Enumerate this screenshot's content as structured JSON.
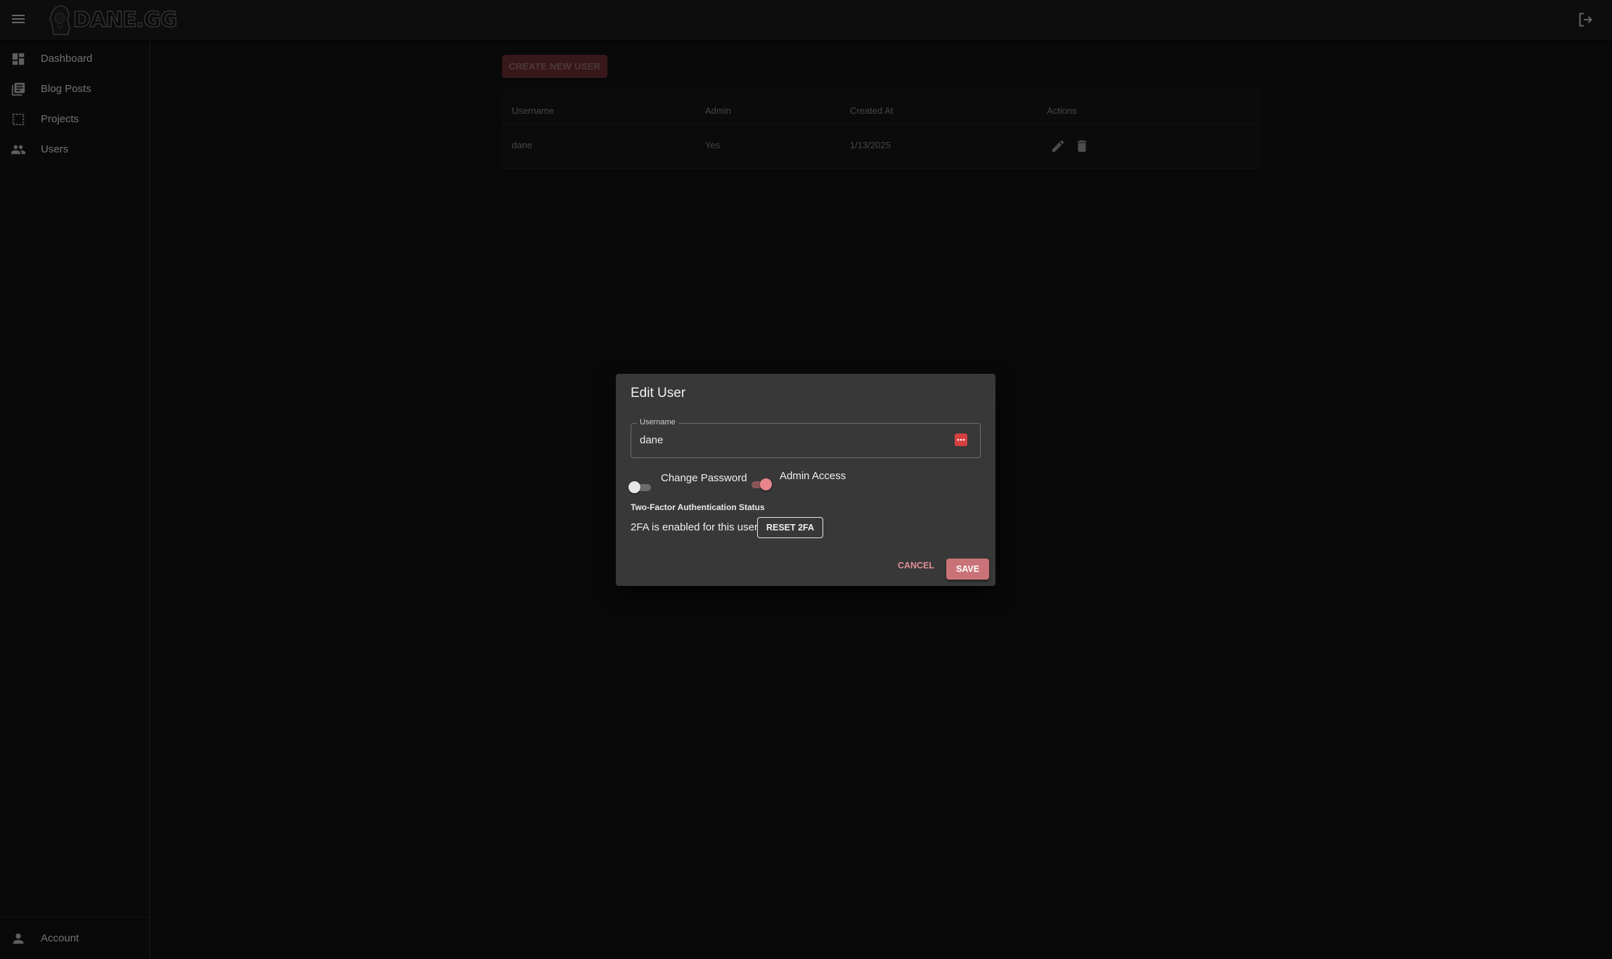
{
  "app": {
    "logo_text": "DANE.GG",
    "menu_icon": "hamburger-menu-icon",
    "logout_icon": "logout-icon"
  },
  "sidebar": {
    "items": [
      {
        "label": "Dashboard",
        "icon": "dashboard-icon"
      },
      {
        "label": "Blog Posts",
        "icon": "library-books-icon"
      },
      {
        "label": "Projects",
        "icon": "dashed-square-icon"
      },
      {
        "label": "Users",
        "icon": "people-icon"
      }
    ],
    "account": {
      "label": "Account",
      "icon": "person-icon"
    }
  },
  "users": {
    "create_label": "CREATE NEW USER",
    "columns": [
      "Username",
      "Admin",
      "Created At",
      "Actions"
    ],
    "rows": [
      {
        "username": "dane",
        "admin": "Yes",
        "created_at": "1/13/2025",
        "actions": [
          "edit-icon",
          "delete-icon"
        ]
      }
    ]
  },
  "dialog": {
    "title": "Edit User",
    "username_label": "Username",
    "username_value": "dane",
    "password_manager_icon": "password-manager-icon",
    "change_password": {
      "label": "Change Password",
      "on": false
    },
    "admin_access": {
      "label": "Admin Access",
      "on": true
    },
    "tfa_title": "Two-Factor Authentication Status",
    "tfa_status": "2FA is enabled for this user",
    "reset_label": "RESET 2FA",
    "cancel_label": "CANCEL",
    "save_label": "SAVE"
  },
  "colors": {
    "accent": "#c97277",
    "accent_text": "#e08f95",
    "background": "#121212",
    "dialog": "#383838"
  }
}
